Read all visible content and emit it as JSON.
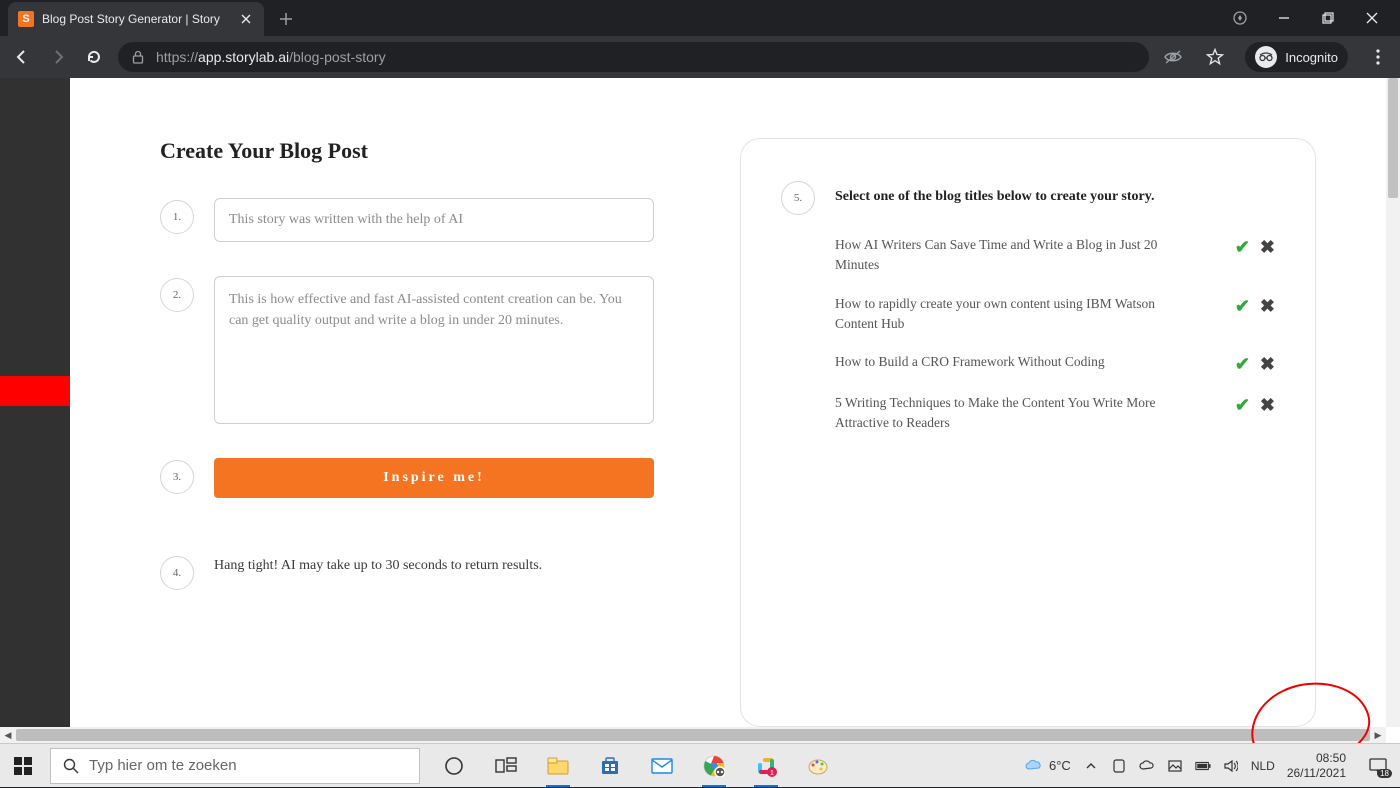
{
  "browser": {
    "tab": {
      "favicon_letter": "S",
      "title": "Blog Post Story Generator | Story"
    },
    "url": {
      "scheme": "https://",
      "host": "app.storylab.ai",
      "path": "/blog-post-story"
    },
    "incognito_label": "Incognito"
  },
  "page": {
    "heading": "Create Your Blog Post",
    "steps": {
      "s1": {
        "num": "1.",
        "input_value": "This story was written with the help of AI"
      },
      "s2": {
        "num": "2.",
        "input_value": "This is how effective and fast AI-assisted content creation can be. You can get quality output and write a blog in under 20 minutes."
      },
      "s3": {
        "num": "3.",
        "button_label": "Inspire me!"
      },
      "s4": {
        "num": "4.",
        "text": "Hang tight! AI may take up to 30 seconds to return results."
      },
      "s5": {
        "num": "5.",
        "title": "Select one of the blog titles below to create your story."
      }
    },
    "titles": [
      " How AI Writers Can Save Time and Write a Blog in Just 20 Minutes",
      " How to rapidly create your own content using IBM Watson Content Hub",
      " How to Build a CRO Framework Without Coding",
      " 5 Writing Techniques to Make the Content You Write More Attractive to Readers"
    ]
  },
  "taskbar": {
    "search_placeholder": "Typ hier om te zoeken",
    "weather_temp": "6°C",
    "lang": "NLD",
    "time": "08:50",
    "date": "26/11/2021",
    "action_center_count": "18"
  }
}
